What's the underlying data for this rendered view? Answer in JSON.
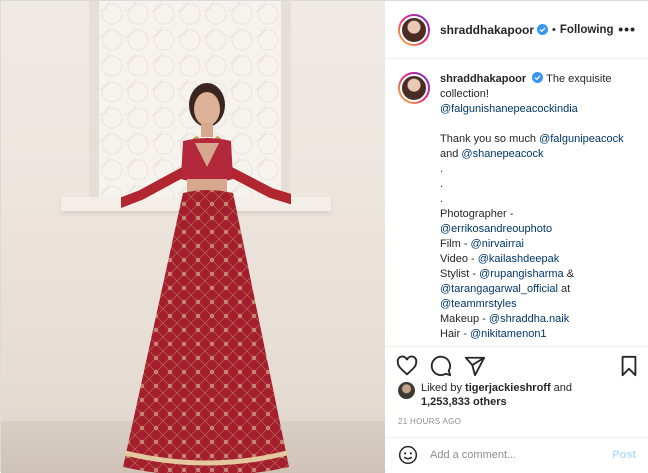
{
  "post": {
    "username": "shraddhakapoor",
    "separator": "•",
    "follow_status": "Following",
    "more_label": "•••"
  },
  "caption": {
    "username": "shraddhakapoor",
    "lines": [
      "The exquisite",
      "collection!",
      "@falgunishanepeacockindia",
      "",
      "Thank you so much @falgunipeacock",
      "and @shanepeacock",
      ".",
      ".",
      ".",
      "Photographer -",
      "@errikosandreouphoto",
      "Film - @nirvairrai",
      "Video - @kailashdeepak",
      "Stylist - @rupangisharma &",
      "@tarangagarwal_official at",
      "@teammrstyles",
      "Makeup - @shraddha.naik",
      "Hair - @nikitamenon1"
    ]
  },
  "likes": {
    "prefix": "Liked by ",
    "user": "tigerjackieshroff",
    "middle": " and",
    "count": "1,253,833 others"
  },
  "timestamp": "21 HOURS AGO",
  "comment": {
    "placeholder": "Add a comment...",
    "post_label": "Post"
  },
  "icons": {
    "heart": "heart-icon",
    "comment": "comment-icon",
    "share": "share-icon",
    "save": "bookmark-icon",
    "emoji": "emoji-icon",
    "verified": "verified-badge-icon"
  },
  "colors": {
    "link": "#00376b",
    "post_button": "#b2dffc",
    "border": "#dbdbdb",
    "muted": "#8e8e8e",
    "verified": "#3897f0"
  }
}
